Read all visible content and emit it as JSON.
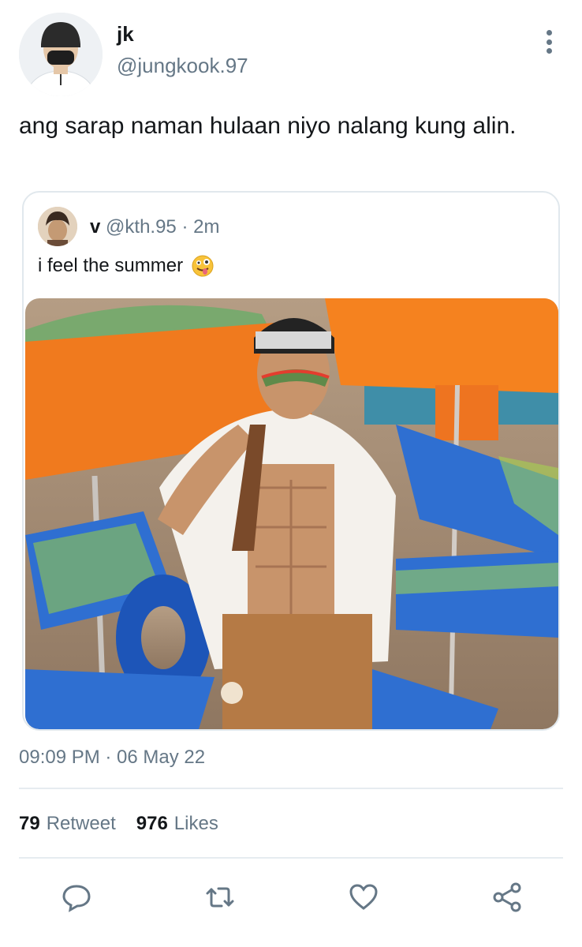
{
  "tweet": {
    "display_name": "jk",
    "handle": "@jungkook.97",
    "text": "ang sarap naman hulaan niyo nalang kung alin.",
    "timestamp": "09:09 PM · 06 May 22"
  },
  "quoted": {
    "display_name": "v",
    "handle": "@kth.95",
    "separator": "·",
    "time": "2m",
    "text": "i feel the summer",
    "emoji": "zany-face-icon"
  },
  "stats": {
    "retweets_count": "79",
    "retweets_label": "Retweet",
    "likes_count": "976",
    "likes_label": "Likes"
  },
  "actions": [
    "reply-icon",
    "retweet-icon",
    "like-icon",
    "share-icon"
  ],
  "colors": {
    "text": "#14171a",
    "secondary": "#657786",
    "border": "#e1e8ed",
    "umbrella_orange": "#f07a1e",
    "chair_blue": "#2f6fd1"
  }
}
